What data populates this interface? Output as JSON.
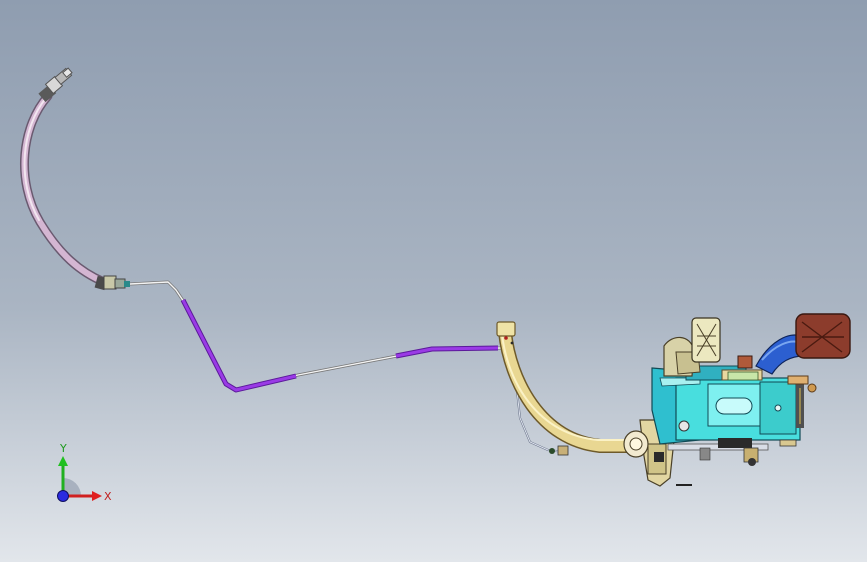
{
  "viewport": {
    "background_top": "#8f9db0",
    "background_bottom": "#e2e6eb"
  },
  "model": {
    "parts": [
      "hose-fitting",
      "flexible-hose",
      "hose-coupling",
      "brake-line",
      "line-sleeve",
      "bent-tube",
      "return-line",
      "pedal-box",
      "clutch-pedal",
      "brake-pedal",
      "master-cylinder",
      "pivot-bolt"
    ],
    "colors": {
      "hose": "#c8a8c8",
      "sleeve": "#8a2ad6",
      "bent_tube": "#e8d58a",
      "pedal_box": "#40d8d8",
      "brake_pedal_arm": "#2c5fd0",
      "pedal_pad": "#8a3a2a",
      "bracket": "#d8d8a8"
    }
  },
  "triad": {
    "x_label": "X",
    "y_label": "Y",
    "x_color": "#e02020",
    "y_color": "#20c020",
    "z_color": "#2020e0"
  }
}
